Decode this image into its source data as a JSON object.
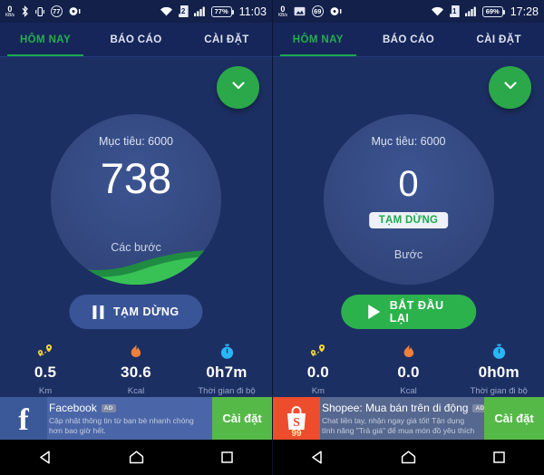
{
  "screens": [
    {
      "id": "left",
      "statusbar": {
        "net_speed_value": "0",
        "net_speed_unit": "KB/s",
        "icons": [
          "bluetooth-icon",
          "vibrate-icon",
          "dnd-count-icon",
          "record-icon"
        ],
        "dnd_count": "77",
        "sim_number": "2",
        "battery_percent": "77%",
        "time": "11:03"
      },
      "tabs": [
        {
          "label": "HÔM NAY",
          "active": true
        },
        {
          "label": "BÁO CÁO",
          "active": false
        },
        {
          "label": "CÀI ĐẶT",
          "active": false
        }
      ],
      "ring": {
        "goal": "Mục tiêu: 6000",
        "steps": "738",
        "caption": "Các bước",
        "paused_badge": "",
        "progress_percent": 12
      },
      "action_button": {
        "label": "TẠM DỪNG",
        "icon": "pause-icon",
        "style": "pause"
      },
      "stats": [
        {
          "icon": "route-pin-icon",
          "value": "0.5",
          "label": "Km"
        },
        {
          "icon": "flame-icon",
          "value": "30.6",
          "label": "Kcal"
        },
        {
          "icon": "stopwatch-icon",
          "value": "0h7m",
          "label": "Thời gian đi bộ"
        }
      ],
      "ad": {
        "brand": "facebook",
        "icon": "facebook-logo-icon",
        "title": "Facebook",
        "badge": "AD",
        "subtitle": "Cập nhật thông tin từ bạn bè nhanh chóng hơn bao giờ hết.",
        "cta": "Cài đặt"
      }
    },
    {
      "id": "right",
      "statusbar": {
        "net_speed_value": "0",
        "net_speed_unit": "KB/s",
        "icons": [
          "screenshot-icon",
          "dnd-count-icon",
          "record-icon"
        ],
        "dnd_count": "69",
        "sim_number": "1",
        "battery_percent": "69%",
        "time": "17:28"
      },
      "tabs": [
        {
          "label": "HÔM NAY",
          "active": true
        },
        {
          "label": "BÁO CÁO",
          "active": false
        },
        {
          "label": "CÀI ĐẶT",
          "active": false
        }
      ],
      "ring": {
        "goal": "Mục tiêu: 6000",
        "steps": "0",
        "caption": "Bước",
        "paused_badge": "TẠM DỪNG",
        "progress_percent": 0
      },
      "action_button": {
        "label": "BẮT ĐẦU LẠI",
        "icon": "play-icon",
        "style": "start"
      },
      "stats": [
        {
          "icon": "route-pin-icon",
          "value": "0.0",
          "label": "Km"
        },
        {
          "icon": "flame-icon",
          "value": "0.0",
          "label": "Kcal"
        },
        {
          "icon": "stopwatch-icon",
          "value": "0h0m",
          "label": "Thời gian đi bộ"
        }
      ],
      "ad": {
        "brand": "shopee",
        "icon": "shopee-logo-icon",
        "title": "Shopee: Mua bán trên di động",
        "badge": "AD",
        "subtitle": "Chat liền tay, nhận ngay giá tốt! Tận dụng tính năng \"Trả giá\" để mua món đồ yêu thích với giá ...",
        "cta": "Cài đặt",
        "logo_text": "99"
      }
    }
  ],
  "fab": {
    "icon": "chevron-down-icon"
  },
  "navbar": [
    {
      "icon": "back-icon"
    },
    {
      "icon": "home-icon"
    },
    {
      "icon": "recents-icon"
    }
  ],
  "colors": {
    "background": "#1c2f63",
    "accent_green": "#2bb24c",
    "ring_fill": "#34487f",
    "tab_active": "#27ae4f",
    "cta_green": "#55b948"
  }
}
